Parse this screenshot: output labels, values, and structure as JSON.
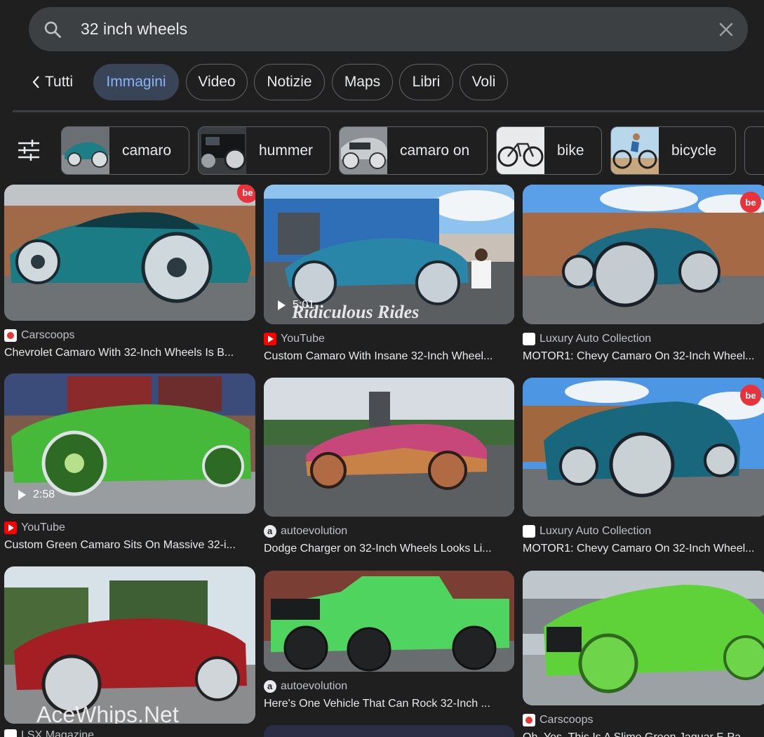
{
  "search": {
    "query": "32 inch wheels"
  },
  "tabs": {
    "back_label": "Tutti",
    "items": [
      "Immagini",
      "Video",
      "Notizie",
      "Maps",
      "Libri",
      "Voli"
    ],
    "active": "Immagini"
  },
  "chips": [
    "camaro",
    "hummer",
    "camaro on",
    "bike",
    "bicycle"
  ],
  "results": [
    {
      "source": "Carscoops",
      "title": "Chevrolet Camaro With 32-Inch Wheels Is B...",
      "badge": "be"
    },
    {
      "source": "YouTube",
      "title": "Custom Camaro With Insane 32-Inch Wheel...",
      "duration": "5:01",
      "watermark": "Ridiculous Rides"
    },
    {
      "source": "Luxury Auto Collection",
      "title": "MOTOR1: Chevy Camaro On 32-Inch Wheel...",
      "badge": "be"
    },
    {
      "source": "YouTube",
      "title": "Custom Green Camaro Sits On Massive 32-i...",
      "duration": "2:58"
    },
    {
      "source": "autoevolution",
      "title": "Dodge Charger on 32-Inch Wheels Looks Li..."
    },
    {
      "source": "Luxury Auto Collection",
      "title": "MOTOR1: Chevy Camaro On 32-Inch Wheel...",
      "badge": "be"
    },
    {
      "source": "LSX Magazine",
      "title": "",
      "watermark": "AceWhips.Net"
    },
    {
      "source": "autoevolution",
      "title": "Here's One Vehicle That Can Rock 32-Inch ..."
    },
    {
      "source": "Carscoops",
      "title": "Oh, Yes, This Is A Slime Green Jaguar F-Pa..."
    }
  ],
  "colors": {
    "background": "#1f1f1f",
    "accent": "#8ab4f8",
    "active_tab": "#394457"
  }
}
